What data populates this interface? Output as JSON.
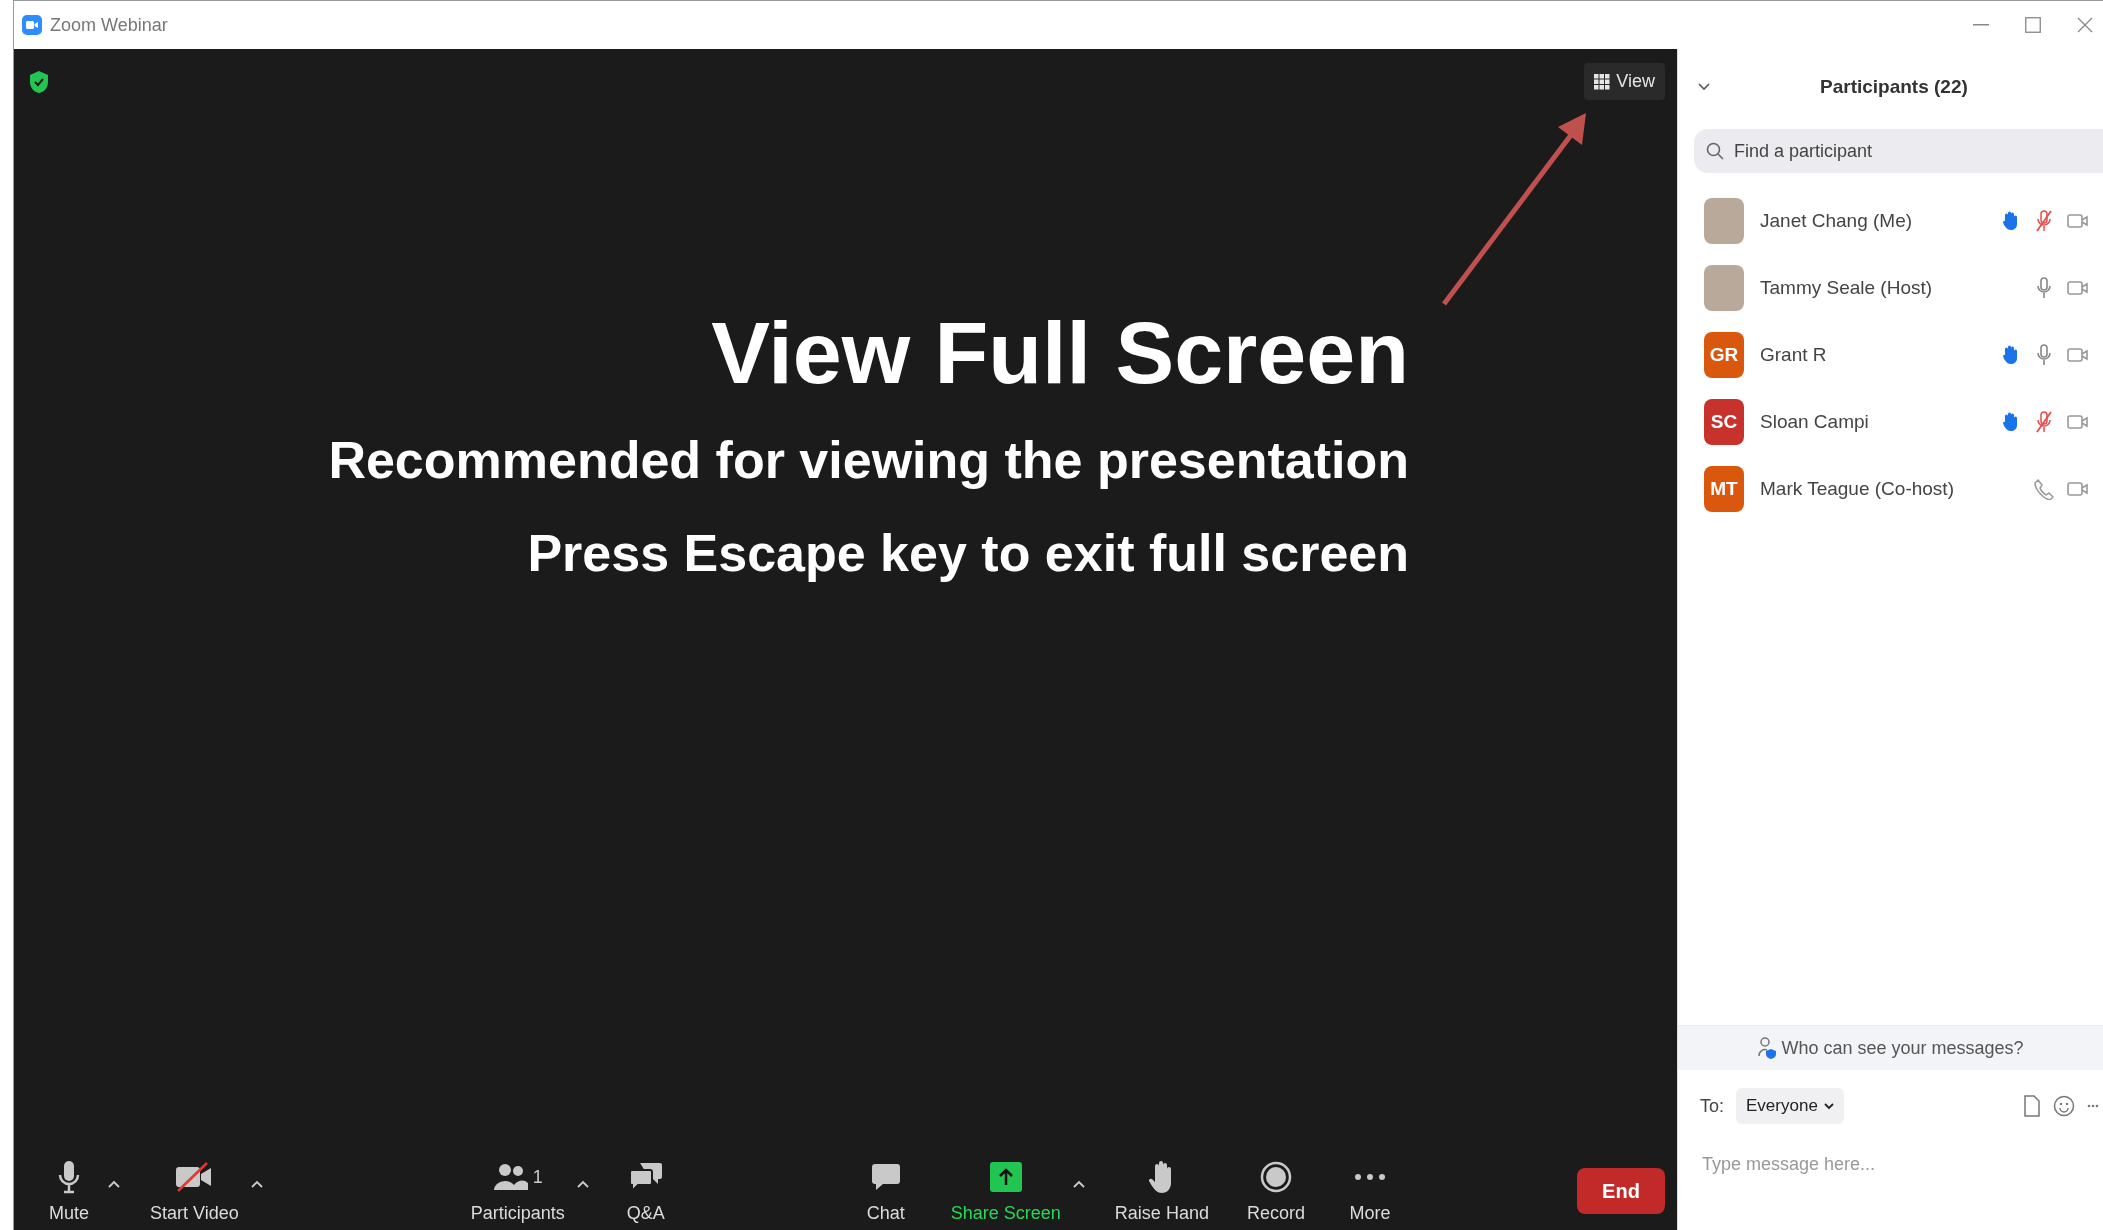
{
  "window": {
    "title": "Zoom Webinar"
  },
  "stage": {
    "view_button": "View",
    "overlay": {
      "title": "View Full Screen",
      "lines": [
        "Recommended for viewing the presentation",
        "Press Escape key to exit full screen"
      ]
    }
  },
  "toolbar": {
    "groups": [
      [
        {
          "kind": "mic",
          "label": "Mute",
          "has_menu": true
        },
        {
          "kind": "video_off",
          "label": "Start Video",
          "has_menu": true
        }
      ],
      [
        {
          "kind": "participants",
          "label": "Participants",
          "count": "1",
          "has_menu": true
        },
        {
          "kind": "qa",
          "label": "Q&A",
          "has_menu": false
        }
      ],
      [
        {
          "kind": "chat",
          "label": "Chat",
          "has_menu": false
        },
        {
          "kind": "share",
          "label": "Share Screen",
          "has_menu": true
        },
        {
          "kind": "hand",
          "label": "Raise Hand",
          "has_menu": false
        },
        {
          "kind": "record",
          "label": "Record",
          "has_menu": false
        },
        {
          "kind": "more",
          "label": "More",
          "has_menu": false
        }
      ]
    ],
    "end_button": "End"
  },
  "participants_panel": {
    "title": "Participants (22)",
    "search": {
      "placeholder": "Find a participant"
    },
    "participants": [
      {
        "name": "Janet Chang (Me)",
        "avatar": {
          "kind": "photo"
        },
        "hand_raised": true,
        "phone": false,
        "muted": true
      },
      {
        "name": "Tammy Seale (Host)",
        "avatar": {
          "kind": "photo"
        },
        "hand_raised": false,
        "phone": false,
        "muted": false
      },
      {
        "name": "Grant R",
        "avatar": {
          "kind": "initials",
          "initials": "GR",
          "color": "#d9580e"
        },
        "hand_raised": true,
        "phone": false,
        "muted": false
      },
      {
        "name": "Sloan Campi",
        "avatar": {
          "kind": "initials",
          "initials": "SC",
          "color": "#c8322c"
        },
        "hand_raised": true,
        "phone": false,
        "muted": true
      },
      {
        "name": "Mark Teague (Co-host)",
        "avatar": {
          "kind": "initials",
          "initials": "MT",
          "color": "#d9580e"
        },
        "hand_raised": false,
        "phone": true
      }
    ]
  },
  "chat": {
    "notice": "Who can see your messages?",
    "to_label": "To:",
    "recipient": "Everyone",
    "message": {
      "placeholder": "Type message here..."
    }
  }
}
